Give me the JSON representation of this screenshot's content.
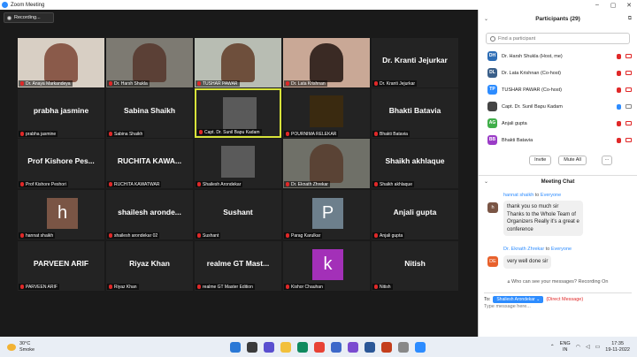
{
  "window": {
    "title": "Zoom Meeting"
  },
  "recording_label": "Recording...",
  "tiles": [
    {
      "label": "Dr. Anaya Markandeya",
      "name": "",
      "type": "video",
      "col": 0,
      "row": 0
    },
    {
      "label": "Dr. Harsh Shukla",
      "name": "",
      "type": "video",
      "col": 1,
      "row": 0
    },
    {
      "label": "TUSHAR PAWAR",
      "name": "",
      "type": "video",
      "col": 2,
      "row": 0
    },
    {
      "label": "Dr. Lata Krishnan",
      "name": "",
      "type": "video",
      "col": 3,
      "row": 0
    },
    {
      "label": "Dr. Kranti Jejurkar",
      "name": "Dr. Kranti Jejurkar",
      "type": "name",
      "col": 4,
      "row": 0
    },
    {
      "label": "prabha jasmine",
      "name": "prabha jasmine",
      "type": "name",
      "col": 0,
      "row": 1
    },
    {
      "label": "Sabina Shaikh",
      "name": "Sabina Shaikh",
      "type": "name",
      "col": 1,
      "row": 1
    },
    {
      "label": "Capt. Dr. Sunil Bapu Kadam",
      "name": "",
      "type": "photo",
      "col": 2,
      "row": 1,
      "active": true
    },
    {
      "label": "POURNIMA RELEKAR",
      "name": "",
      "type": "photo",
      "col": 3,
      "row": 1
    },
    {
      "label": "Bhakti Batavia",
      "name": "Bhakti Batavia",
      "type": "name",
      "col": 4,
      "row": 1
    },
    {
      "label": "Prof Kishore Peshori",
      "name": "Prof Kishore Pes...",
      "type": "name",
      "col": 0,
      "row": 2
    },
    {
      "label": "RUCHITA KAWATWAR",
      "name": "RUCHITA KAWA...",
      "type": "name",
      "col": 1,
      "row": 2
    },
    {
      "label": "Shailesh Arondekar",
      "name": "",
      "type": "photo",
      "col": 2,
      "row": 2
    },
    {
      "label": "Dr. Eknath Zhrekar",
      "name": "",
      "type": "video",
      "col": 3,
      "row": 2
    },
    {
      "label": "Shaikh akhlaque",
      "name": "Shaikh akhlaque",
      "type": "name",
      "col": 4,
      "row": 2
    },
    {
      "label": "hannat shaikh",
      "name": "h",
      "type": "avatar",
      "col": 0,
      "row": 3,
      "color": "#7a5545"
    },
    {
      "label": "shailesh arondekar 02",
      "name": "shailesh aronde...",
      "type": "name",
      "col": 1,
      "row": 3
    },
    {
      "label": "Sushant",
      "name": "Sushant",
      "type": "name",
      "col": 2,
      "row": 3
    },
    {
      "label": "Parag Karulkar",
      "name": "P",
      "type": "avatar",
      "col": 3,
      "row": 3,
      "color": "#6d7f8c"
    },
    {
      "label": "Anjali gupta",
      "name": "Anjali gupta",
      "type": "name",
      "col": 4,
      "row": 3
    },
    {
      "label": "PARVEEN ARIF",
      "name": "PARVEEN ARIF",
      "type": "name",
      "col": 0,
      "row": 4
    },
    {
      "label": "Riyaz Khan",
      "name": "Riyaz Khan",
      "type": "name",
      "col": 1,
      "row": 4
    },
    {
      "label": "realme GT Master Edition",
      "name": "realme GT Mast...",
      "type": "name",
      "col": 2,
      "row": 4
    },
    {
      "label": "Kishor Chauhan",
      "name": "k",
      "type": "avatar",
      "col": 3,
      "row": 4,
      "color": "#a330b8"
    },
    {
      "label": "Nitish",
      "name": "Nitish",
      "type": "name",
      "col": 4,
      "row": 4
    }
  ],
  "participants": {
    "title": "Participants (29)",
    "search_placeholder": "Find a participant",
    "items": [
      {
        "initials": "DH",
        "name": "Dr. Harsh Shukla (Host, me)",
        "color": "#2d6db5"
      },
      {
        "initials": "DL",
        "name": "Dr. Lata Krishnan (Co-host)",
        "color": "#3a5f8a"
      },
      {
        "initials": "TP",
        "name": "TUSHAR PAWAR (Co-host)",
        "color": "#2d8cff"
      },
      {
        "initials": "",
        "name": "Capt. Dr. Sunil Bapu Kadam",
        "color": "#444444"
      },
      {
        "initials": "AG",
        "name": "Anjali gupta",
        "color": "#3fae49"
      },
      {
        "initials": "BB",
        "name": "Bhakti Batavia",
        "color": "#9b3cc7"
      }
    ],
    "invite_label": "Invite",
    "mute_all_label": "Mute All",
    "more_label": "..."
  },
  "chat": {
    "title": "Meeting Chat",
    "messages": [
      {
        "avatar": "h",
        "avatar_color": "#7a5545",
        "from": "hannat shaikh",
        "to_prefix": "to",
        "to": "Everyone",
        "lines": [
          "thank you so much sir",
          "Thanks to the Whole Team of",
          "Organizers Really it's a great e",
          "conference"
        ]
      },
      {
        "avatar": "DE",
        "avatar_color": "#e8612c",
        "from": "Dr. Eknath Zhrekar",
        "to_prefix": "to",
        "to": "Everyone",
        "lines": [
          "very well done sir"
        ]
      }
    ],
    "notice": "Who can see your messages? Recording On",
    "to_label": "To:",
    "to_value": "Shailesh Arondekar",
    "direct_label": "(Direct Message)",
    "input_placeholder": "Type message here..."
  },
  "taskbar": {
    "temp": "30°C",
    "weather": "Smoke",
    "lang1": "ENG",
    "lang2": "IN",
    "time": "17:35",
    "date": "19-11-2022"
  }
}
